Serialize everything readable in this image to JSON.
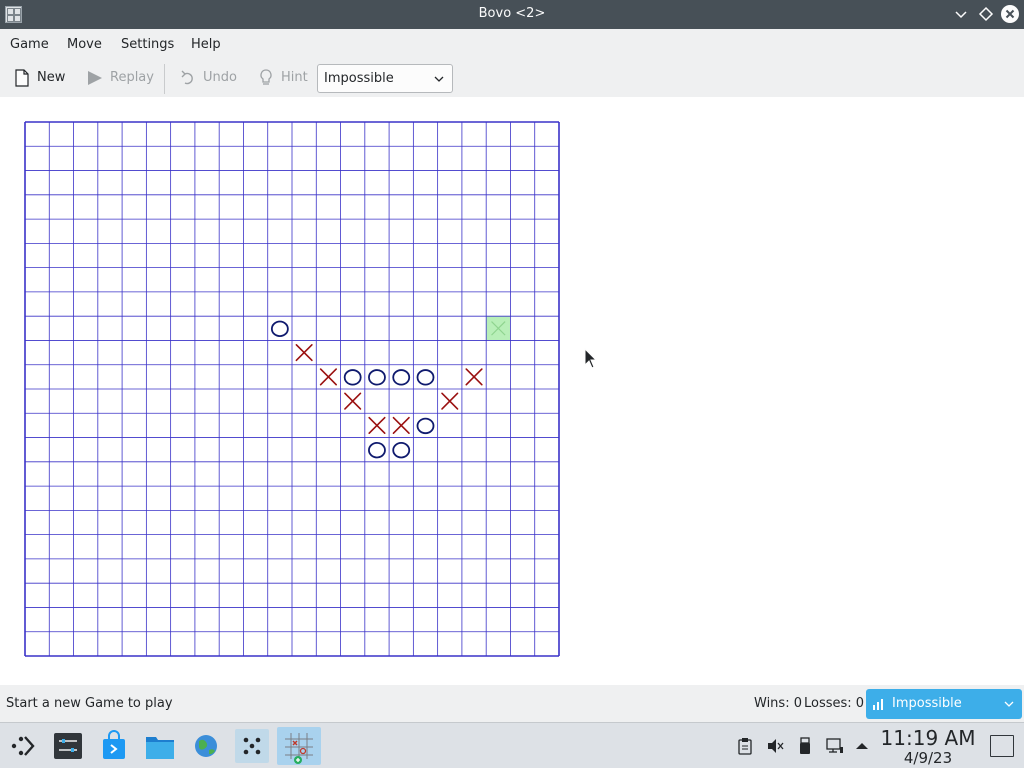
{
  "window": {
    "title": "Bovo <2>"
  },
  "menubar": {
    "items": [
      "Game",
      "Move",
      "Settings",
      "Help"
    ]
  },
  "toolbar": {
    "new_label": "New",
    "replay_label": "Replay",
    "undo_label": "Undo",
    "hint_label": "Hint",
    "difficulty_value": "Impossible"
  },
  "board": {
    "size": 22,
    "line_color": "#3a32c8",
    "x_color": "#9a1010",
    "o_color": "#0f1a6e",
    "hint_color": "#b8efb8",
    "x_marks": [
      [
        11,
        9
      ],
      [
        12,
        10
      ],
      [
        18,
        10
      ],
      [
        13,
        11
      ],
      [
        17,
        11
      ],
      [
        14,
        12
      ],
      [
        15,
        12
      ]
    ],
    "o_marks": [
      [
        10,
        8
      ],
      [
        13,
        10
      ],
      [
        14,
        10
      ],
      [
        15,
        10
      ],
      [
        16,
        10
      ],
      [
        16,
        12
      ],
      [
        14,
        13
      ],
      [
        15,
        13
      ]
    ],
    "hint_cell": [
      19,
      8
    ]
  },
  "statusbar": {
    "message": "Start a new Game to play",
    "wins": "Wins: 0",
    "losses": "Losses: 0",
    "difficulty_value": "Impossible"
  },
  "taskbar": {
    "time": "11:19 AM",
    "date": "4/9/23"
  },
  "colors": {
    "titlebar": "#475057",
    "accent": "#3daee9",
    "chrome": "#eff0f1"
  }
}
